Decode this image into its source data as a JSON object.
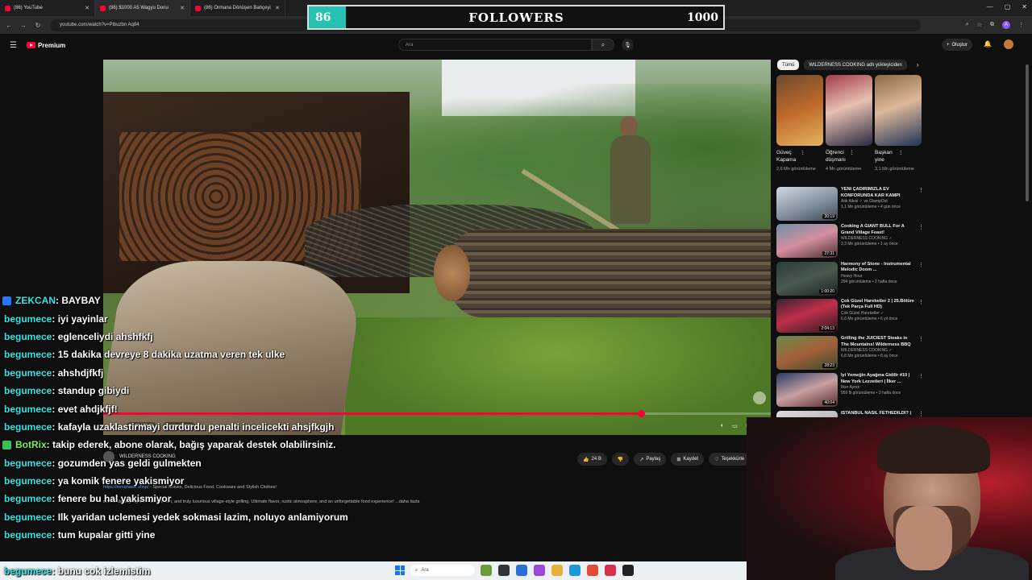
{
  "browser": {
    "tabs": [
      {
        "label": "(86) YouTube"
      },
      {
        "label": "(86) $1000 A5 Wagyu Donu"
      },
      {
        "label": "(86) Ormana Dönüşen Bahçeyi"
      }
    ],
    "url": "youtube.com/watch?v=Plbuzbn Aq84"
  },
  "followers": {
    "count": "86",
    "label": "FOLLOWERS",
    "goal": "1000"
  },
  "youtube": {
    "logo": "Premium",
    "search_placeholder": "Ara",
    "create_label": "Oluştur"
  },
  "player": {
    "time": "19:13 / 23:41",
    "chapter": "Serving Doner",
    "progress_fraction": 0.805
  },
  "video_info": {
    "channel": "WILDERNESS COOKING",
    "like_count": "24 B",
    "share_label": "Paylaş",
    "save_label": "Kaydet",
    "thanks_label": "Teşekkürle",
    "desc_link": "https://tomahawk.shop/",
    "desc_link_text": "- Special Knives, Delicious Food, Cookware and Stylish Clothes!",
    "desc_text": "over a blazing log fire—tender, rich, and truly luxurious village-style grilling. Ultimate flavor, rustic atmosphere, and an unforgettable food experience!",
    "desc_more": "...daha fazla"
  },
  "chips": {
    "all": "Tümü",
    "channel": "WILDERNESS COOKING adlı yükleyiciden"
  },
  "shorts": [
    {
      "title": "Güveç Kapama Eli...",
      "views": "2,6 Mn görüntüleme"
    },
    {
      "title": "Öğrenci düşmanı ...",
      "views": "4 Mn görüntüleme"
    },
    {
      "title": "Başkan yine formunda",
      "views": "3,1 Mn görüntüleme"
    }
  ],
  "recommendations": [
    {
      "title": "YENİ ÇADIRIMIZLA EV KONFORUNDA KAR KAMPI",
      "channel": "Atik Ailesi ✓ ve GlampOut",
      "meta": "1,1 Mn görüntüleme • 4 gün önce",
      "badge": "Yeni",
      "duration": "30:19"
    },
    {
      "title": "Cooking A GIANT BULL For A Grand Village Feast!",
      "channel": "WILDERNESS COOKING ✓",
      "meta": "3,3 Mn görüntüleme • 1 ay önce",
      "badge": "",
      "duration": "27:31"
    },
    {
      "title": "Harmony of Stone - Instrumental Melodic Doom ...",
      "channel": "Heavy Hour",
      "meta": "294 görüntüleme • 2 hafta önce",
      "badge": "",
      "duration": "1:00:20"
    },
    {
      "title": "Çok Güzel Hareketler 2 | 25.Bölüm (Tek Parça Full HD)",
      "channel": "Çok Güzel Hareketler ✓",
      "meta": "6,6 Mn görüntüleme • 6 yıl önce",
      "badge": "",
      "duration": "2:04:13"
    },
    {
      "title": "Grilling the JUICIEST Steaks in The Mountains! Wilderness BBQ",
      "channel": "WILDERNESS COOKING ✓",
      "meta": "6,8 Mn görüntüleme • 8 ay önce",
      "badge": "",
      "duration": "28:23"
    },
    {
      "title": "İyi Yemeğin Ayağına Gidilir #10 | New York Lezzetleri | İlker ...",
      "channel": "İlker Aynık",
      "meta": "959 B görüntüleme • 3 hafta önce",
      "badge": "",
      "duration": "40:04"
    },
    {
      "title": "İSTANBUL NASIL FETHEDİLDİ? |",
      "channel": "",
      "meta": "",
      "badge": "",
      "duration": ""
    }
  ],
  "chat": [
    {
      "user": "ZEKCAN",
      "msg": " : BAYBAY",
      "badge": "blue"
    },
    {
      "user": "begumece",
      "msg": " : iyi yayinlar",
      "badge": ""
    },
    {
      "user": "begumece",
      "msg": " : eglenceliydi ahshfkfj",
      "badge": ""
    },
    {
      "user": "begumece",
      "msg": " : 15 dakika devreye 8 dakika uzatma veren tek ulke",
      "badge": ""
    },
    {
      "user": "begumece",
      "msg": " : ahshdjfkfj",
      "badge": ""
    },
    {
      "user": "begumece",
      "msg": " : standup gibiydi",
      "badge": ""
    },
    {
      "user": "begumece",
      "msg": " : evet ahdjkfjf!",
      "badge": ""
    },
    {
      "user": "begumece",
      "msg": " : kafayla uzaklastirmayi durdurdu penalti incelicekti ahsjfkgjh",
      "badge": ""
    },
    {
      "user": "BotRix",
      "msg": " : takip ederek, abone olarak, bağış yaparak destek olabilirsiniz.",
      "badge": "green"
    },
    {
      "user": "begumece",
      "msg": " : gozumden yas geldi gulmekten",
      "badge": ""
    },
    {
      "user": "begumece",
      "msg": " : ya komik fenere yakismiyor",
      "badge": ""
    },
    {
      "user": "begumece",
      "msg": " : fenere bu hal yakismiyor",
      "badge": ""
    },
    {
      "user": "begumece",
      "msg": " : Ilk yaridan uclemesi yedek sokmasi lazim, noluyo anlamiyorum",
      "badge": ""
    },
    {
      "user": "begumece",
      "msg": " : tum kupalar gitti yine",
      "badge": ""
    },
    {
      "user": "begumece",
      "msg": " : bunu cok izlemistim",
      "badge": ""
    }
  ],
  "taskbar": {
    "search_placeholder": "Ara"
  },
  "colors": {
    "accent": "#ff0033",
    "followers_count_bg": "#27c1b3",
    "chat_user": "#2ee6e6"
  }
}
